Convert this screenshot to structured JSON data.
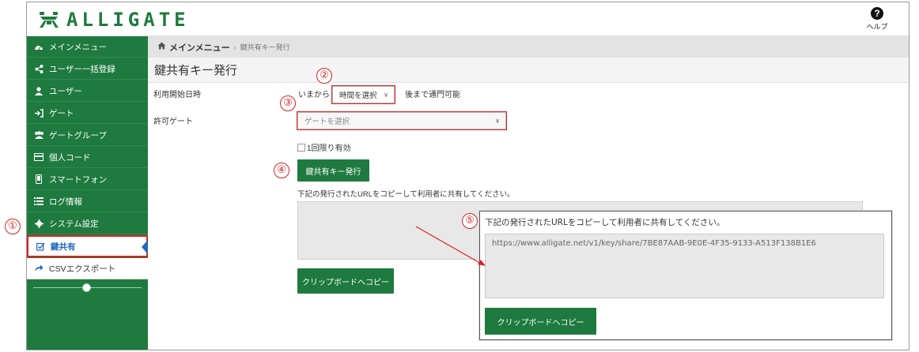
{
  "header": {
    "logo_text": "ALLIGATE",
    "help_label": "ヘルプ",
    "brand_color": "#1e7a3e"
  },
  "sidebar": {
    "items": [
      {
        "label": "メインメニュー",
        "icon": "dashboard-icon"
      },
      {
        "label": "ユーザー一括登録",
        "icon": "share-icon"
      },
      {
        "label": "ユーザー",
        "icon": "user-icon"
      },
      {
        "label": "ゲート",
        "icon": "sign-in-icon"
      },
      {
        "label": "ゲートグループ",
        "icon": "users-icon"
      },
      {
        "label": "個人コード",
        "icon": "card-icon"
      },
      {
        "label": "スマートフォン",
        "icon": "smartphone-icon"
      },
      {
        "label": "ログ情報",
        "icon": "list-icon"
      },
      {
        "label": "システム設定",
        "icon": "gear-icon"
      }
    ],
    "active_item": {
      "label": "鍵共有",
      "icon": "checkbox-edit-icon"
    },
    "sub_item": {
      "label": "CSVエクスポート",
      "icon": "share-arrow-icon"
    }
  },
  "breadcrumb": {
    "home": "メインメニュー",
    "current": "鍵共有キー発行"
  },
  "page": {
    "title": "鍵共有キー発行"
  },
  "form": {
    "start_label": "利用開始日時",
    "from_now": "いまから",
    "time_select_value": "時間を選択",
    "time_suffix": "後まで通門可能",
    "gate_label": "許可ゲート",
    "gate_select_placeholder": "ゲートを選択",
    "once_label": "1回限り有効",
    "issue_button": "鍵共有キー発行",
    "instruction": "下記の発行されたURLをコピーして利用者に共有してください。",
    "copy_button": "クリップボードへコピー"
  },
  "callout": {
    "instruction": "下記の発行されたURLをコピーして利用者に共有してください。",
    "url": "https://www.alligate.net/v1/key/share/7BE87AAB-9E0E-4F35-9133-A513F138B1E6",
    "copy_button": "クリップボードへコピー"
  },
  "annotations": {
    "n1": "①",
    "n2": "②",
    "n3": "③",
    "n4": "④",
    "n5": "⑤",
    "color": "#e02020"
  }
}
